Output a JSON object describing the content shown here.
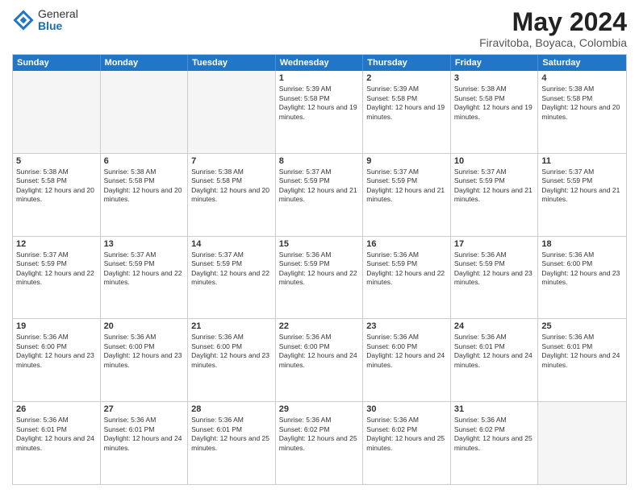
{
  "logo": {
    "general": "General",
    "blue": "Blue"
  },
  "title": "May 2024",
  "subtitle": "Firavitoba, Boyaca, Colombia",
  "days": [
    "Sunday",
    "Monday",
    "Tuesday",
    "Wednesday",
    "Thursday",
    "Friday",
    "Saturday"
  ],
  "rows": [
    [
      {
        "day": "",
        "empty": true
      },
      {
        "day": "",
        "empty": true
      },
      {
        "day": "",
        "empty": true
      },
      {
        "day": "1",
        "sunrise": "5:39 AM",
        "sunset": "5:58 PM",
        "daylight": "12 hours and 19 minutes."
      },
      {
        "day": "2",
        "sunrise": "5:39 AM",
        "sunset": "5:58 PM",
        "daylight": "12 hours and 19 minutes."
      },
      {
        "day": "3",
        "sunrise": "5:38 AM",
        "sunset": "5:58 PM",
        "daylight": "12 hours and 19 minutes."
      },
      {
        "day": "4",
        "sunrise": "5:38 AM",
        "sunset": "5:58 PM",
        "daylight": "12 hours and 20 minutes."
      }
    ],
    [
      {
        "day": "5",
        "sunrise": "5:38 AM",
        "sunset": "5:58 PM",
        "daylight": "12 hours and 20 minutes."
      },
      {
        "day": "6",
        "sunrise": "5:38 AM",
        "sunset": "5:58 PM",
        "daylight": "12 hours and 20 minutes."
      },
      {
        "day": "7",
        "sunrise": "5:38 AM",
        "sunset": "5:58 PM",
        "daylight": "12 hours and 20 minutes."
      },
      {
        "day": "8",
        "sunrise": "5:37 AM",
        "sunset": "5:59 PM",
        "daylight": "12 hours and 21 minutes."
      },
      {
        "day": "9",
        "sunrise": "5:37 AM",
        "sunset": "5:59 PM",
        "daylight": "12 hours and 21 minutes."
      },
      {
        "day": "10",
        "sunrise": "5:37 AM",
        "sunset": "5:59 PM",
        "daylight": "12 hours and 21 minutes."
      },
      {
        "day": "11",
        "sunrise": "5:37 AM",
        "sunset": "5:59 PM",
        "daylight": "12 hours and 21 minutes."
      }
    ],
    [
      {
        "day": "12",
        "sunrise": "5:37 AM",
        "sunset": "5:59 PM",
        "daylight": "12 hours and 22 minutes."
      },
      {
        "day": "13",
        "sunrise": "5:37 AM",
        "sunset": "5:59 PM",
        "daylight": "12 hours and 22 minutes."
      },
      {
        "day": "14",
        "sunrise": "5:37 AM",
        "sunset": "5:59 PM",
        "daylight": "12 hours and 22 minutes."
      },
      {
        "day": "15",
        "sunrise": "5:36 AM",
        "sunset": "5:59 PM",
        "daylight": "12 hours and 22 minutes."
      },
      {
        "day": "16",
        "sunrise": "5:36 AM",
        "sunset": "5:59 PM",
        "daylight": "12 hours and 22 minutes."
      },
      {
        "day": "17",
        "sunrise": "5:36 AM",
        "sunset": "5:59 PM",
        "daylight": "12 hours and 23 minutes."
      },
      {
        "day": "18",
        "sunrise": "5:36 AM",
        "sunset": "6:00 PM",
        "daylight": "12 hours and 23 minutes."
      }
    ],
    [
      {
        "day": "19",
        "sunrise": "5:36 AM",
        "sunset": "6:00 PM",
        "daylight": "12 hours and 23 minutes."
      },
      {
        "day": "20",
        "sunrise": "5:36 AM",
        "sunset": "6:00 PM",
        "daylight": "12 hours and 23 minutes."
      },
      {
        "day": "21",
        "sunrise": "5:36 AM",
        "sunset": "6:00 PM",
        "daylight": "12 hours and 23 minutes."
      },
      {
        "day": "22",
        "sunrise": "5:36 AM",
        "sunset": "6:00 PM",
        "daylight": "12 hours and 24 minutes."
      },
      {
        "day": "23",
        "sunrise": "5:36 AM",
        "sunset": "6:00 PM",
        "daylight": "12 hours and 24 minutes."
      },
      {
        "day": "24",
        "sunrise": "5:36 AM",
        "sunset": "6:01 PM",
        "daylight": "12 hours and 24 minutes."
      },
      {
        "day": "25",
        "sunrise": "5:36 AM",
        "sunset": "6:01 PM",
        "daylight": "12 hours and 24 minutes."
      }
    ],
    [
      {
        "day": "26",
        "sunrise": "5:36 AM",
        "sunset": "6:01 PM",
        "daylight": "12 hours and 24 minutes."
      },
      {
        "day": "27",
        "sunrise": "5:36 AM",
        "sunset": "6:01 PM",
        "daylight": "12 hours and 24 minutes."
      },
      {
        "day": "28",
        "sunrise": "5:36 AM",
        "sunset": "6:01 PM",
        "daylight": "12 hours and 25 minutes."
      },
      {
        "day": "29",
        "sunrise": "5:36 AM",
        "sunset": "6:02 PM",
        "daylight": "12 hours and 25 minutes."
      },
      {
        "day": "30",
        "sunrise": "5:36 AM",
        "sunset": "6:02 PM",
        "daylight": "12 hours and 25 minutes."
      },
      {
        "day": "31",
        "sunrise": "5:36 AM",
        "sunset": "6:02 PM",
        "daylight": "12 hours and 25 minutes."
      },
      {
        "day": "",
        "empty": true
      }
    ]
  ]
}
